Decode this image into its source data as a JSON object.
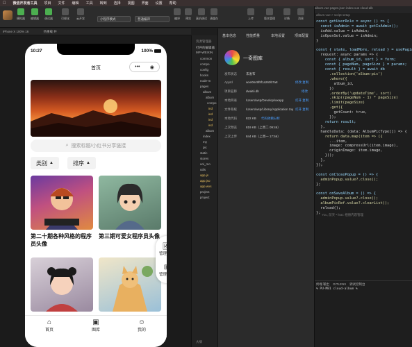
{
  "menubar": {
    "app": "微信开发者工具",
    "items": [
      "项目",
      "文件",
      "编辑",
      "工具",
      "转到",
      "选择",
      "视图",
      "界面",
      "设置",
      "帮助"
    ],
    "window_title": "微信开发者工具 Stable v1.06.2306020",
    "right": "rezip-mp-web",
    "clock": "微信小程序开发"
  },
  "toolbar": {
    "avatar_label": "",
    "buttons": [
      "模拟器",
      "编辑器",
      "调试器",
      "可视化",
      "云开发"
    ],
    "mode_select": "小程序模式",
    "compile_select": "普通编译",
    "right_buttons": [
      "编译",
      "预览",
      "真机调试",
      "清缓存"
    ],
    "far_right": [
      "上传",
      "版本管理",
      "详情",
      "消息"
    ]
  },
  "subbar": {
    "device": "iPhone X 100% 16",
    "hot": "热重载 开"
  },
  "phone": {
    "time": "10:27",
    "battery": "100%",
    "nav_title": "首页",
    "search_placeholder": "搜索标题/小红书分享链接",
    "filters": [
      "类别",
      "排序"
    ],
    "cards": [
      {
        "caption": "第二十期各种风格的程序员头像"
      },
      {
        "caption": "第三期可爱女程序员头像"
      },
      {
        "caption": ""
      },
      {
        "caption": ""
      }
    ],
    "fab": [
      "管理相册",
      "管理分类"
    ],
    "tabs": [
      "首页",
      "图库",
      "我的"
    ]
  },
  "tree": {
    "header": "资源管理器",
    "rows": [
      "打开的编辑器",
      "MP-WEIXIN",
      "common",
      "compo",
      "config",
      "hooks",
      "node-m",
      "pages",
      "album",
      "album",
      "compo",
      "ind",
      "ind",
      "ind",
      "ind",
      "album",
      "index",
      "my",
      "pic",
      "static",
      "stores",
      "uni_mo",
      "utils",
      "app.js",
      "app.jso",
      "app.wxs",
      "project",
      "project"
    ],
    "footer": "大纲"
  },
  "detail": {
    "tabs": [
      "基本信息",
      "性能质量",
      "本地设置",
      "项目配置"
    ],
    "app_name": "一奇图库",
    "rows": [
      {
        "label": "发布状态",
        "value": "未发布"
      },
      {
        "label": "AppId",
        "value": "wxe0649f9f1a260b7a8",
        "link": "修改 复制"
      },
      {
        "label": "项目名称",
        "value": "dwaitii.db",
        "link": "修改"
      },
      {
        "label": "本地目录",
        "value": "/Users/wsp/Develop/wxapp",
        "link": "打开 复制"
      },
      {
        "label": "文件系统",
        "value": "/Users/wsp/Library/Application Supp",
        "link": "打开 复制"
      },
      {
        "label": "本地代码",
        "value": "822 KB",
        "link": "代码依赖分析"
      },
      {
        "label": "上次预览",
        "value": "819 KB（上周二 09:46）"
      },
      {
        "label": "上次上传",
        "value": "844 KB（上周一 17:56）"
      }
    ]
  },
  "editor": {
    "tabs": "album.vue  pages.json  index.vue  cloud-alb",
    "breadcrumb": "album.vue > script setup",
    "lines": [
      "const getUserRole = async () => {",
      "  const isAdmin = await getIsAdmin();",
      "  isAdd.value = isAdmin;",
      "  isOpenSet.value = isAdmin;",
      "}",
      "",
      "const { state, loadMore, reload } = usePaging",
      "  request: async params => {",
      "    const { album_id, sort } = form;",
      "    const { pageNum, pageSize } = params;",
      "    const { result } = await db",
      "      .collection('album-pic')",
      "      .where({",
      "        album_id,",
      "      })",
      "      .orderBy('updateTime', sort)",
      "      .skip((pageNum - 1) * pageSize)",
      "      .limit(pageSize)",
      "      .get({",
      "        getCount: true,",
      "      });",
      "    return result;",
      "  },",
      "  handleData: (data: AlbumPicType[]) => {",
      "    return data.map(item => ({",
      "      ...item,",
      "      image: compressUrl(item.image),",
      "      originImage: item.image,",
      "    }));",
      "  },",
      "});",
      "",
      "const onClosePopup = () => {",
      "  adminPopup.value?.close();",
      "};",
      "",
      "const onSaveAlbum = () => {",
      "  adminPopup.value?.close();",
      "  albumPicRef.value?.clearList();",
      "  reload();",
      "};"
    ],
    "hint": "You, 前天 • feat: 相册内容管理",
    "term_tabs": [
      "终端",
      "输出",
      "GITLENS",
      "调试控制台"
    ],
    "term_line": "% PU-MB1 cloud-album %"
  }
}
